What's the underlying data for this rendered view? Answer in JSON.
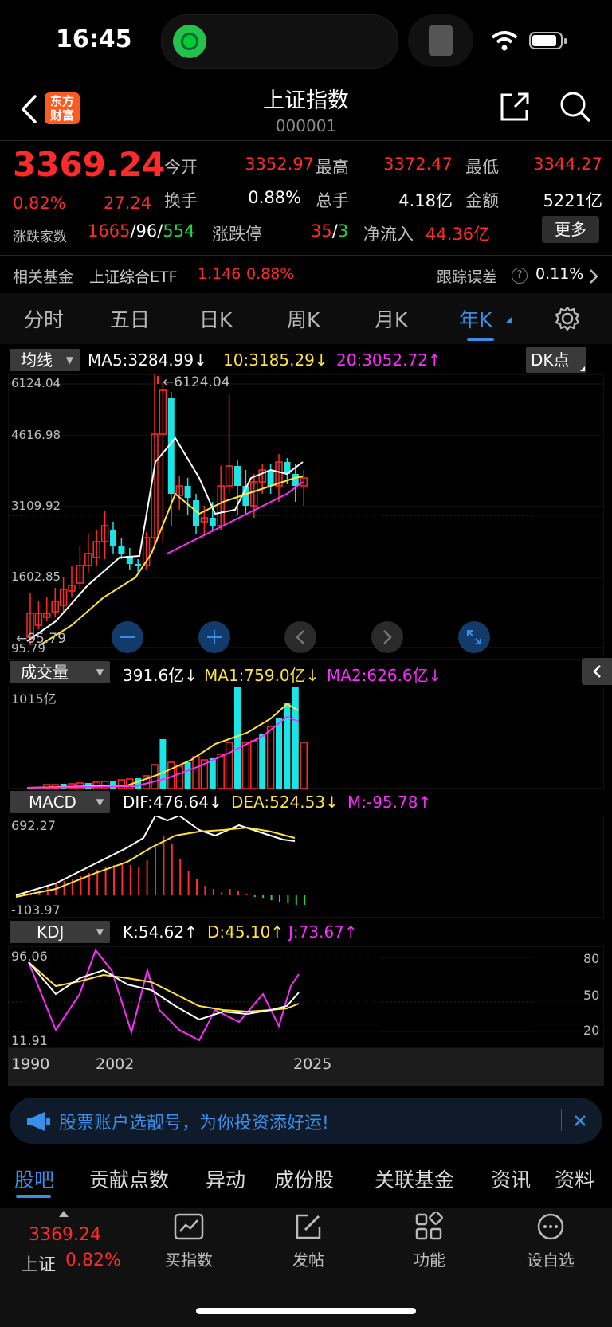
{
  "status": {
    "time": "16:45"
  },
  "header": {
    "brand": "东方财富",
    "title": "上证指数",
    "code": "000001"
  },
  "quote": {
    "price": "3369.24",
    "change_pct": "0.82%",
    "change": "27.24",
    "open_label": "今开",
    "open": "3352.97",
    "high_label": "最高",
    "high": "3372.47",
    "low_label": "最低",
    "low": "3344.27",
    "turnover_label": "换手",
    "turnover": "0.88%",
    "volume_label": "总手",
    "volume": "4.18亿",
    "amount_label": "金额",
    "amount": "5221亿",
    "breadth_label": "涨跌家数",
    "up_count": "1665",
    "flat_count": "96",
    "down_count": "554",
    "limit_label": "涨跌停",
    "limit_up": "35",
    "limit_down": "3",
    "netflow_label": "净流入",
    "netflow": "44.36亿",
    "more_label": "更多"
  },
  "fund": {
    "label": "相关基金",
    "name": "上证综合ETF",
    "price": "1.146",
    "pct": "0.88%",
    "error_label": "跟踪误差",
    "error_value": "0.11%"
  },
  "tabs": [
    {
      "label": "分时",
      "active": false
    },
    {
      "label": "五日",
      "active": false
    },
    {
      "label": "日K",
      "active": false
    },
    {
      "label": "周K",
      "active": false
    },
    {
      "label": "月K",
      "active": false
    },
    {
      "label": "年K",
      "active": true
    }
  ],
  "ma": {
    "selector": "均线",
    "ma5": "MA5:3284.99",
    "ma10": "10:3185.29",
    "ma20": "20:3052.72",
    "dk_label": "DK点"
  },
  "kline_axis": {
    "labels": [
      "6124.04",
      "4616.98",
      "3109.92",
      "1602.85",
      "95.79"
    ],
    "high_marker": "6124.04",
    "low_marker": "95.79"
  },
  "volume_panel": {
    "selector": "成交量",
    "value": "391.6亿",
    "ma1": "MA1:759.0亿",
    "ma2": "MA2:626.6亿",
    "axis_max": "1015亿"
  },
  "macd_panel": {
    "selector": "MACD",
    "dif": "DIF:476.64",
    "dea": "DEA:524.53",
    "m": "M:-95.78",
    "axis_max": "692.27",
    "axis_min": "-103.97"
  },
  "kdj_panel": {
    "selector": "KDJ",
    "k": "K:54.62",
    "d": "D:45.10",
    "j": "J:73.67",
    "axis_max": "96.06",
    "axis_min": "11.91",
    "right_labels": [
      "80",
      "50",
      "20"
    ]
  },
  "xaxis": {
    "labels": [
      "1990",
      "2002",
      "2025"
    ]
  },
  "banner": {
    "text": "股票账户选靓号，为你投资添好运!"
  },
  "bottom_tabs": [
    "股吧",
    "贡献点数",
    "异动",
    "成份股",
    "关联基金",
    "资讯",
    "资料"
  ],
  "footer": {
    "index_name": "上证",
    "price": "3369.24",
    "pct": "0.82%",
    "actions": [
      "买指数",
      "发帖",
      "功能",
      "设自选"
    ]
  },
  "colors": {
    "up": "#ff2a2a",
    "down": "#22d44a",
    "cyan": "#18e6e6",
    "ma_white": "#ffffff",
    "ma_yellow": "#ffe23a",
    "ma_magenta": "#ff2bff",
    "accent": "#2f7fd6"
  }
}
